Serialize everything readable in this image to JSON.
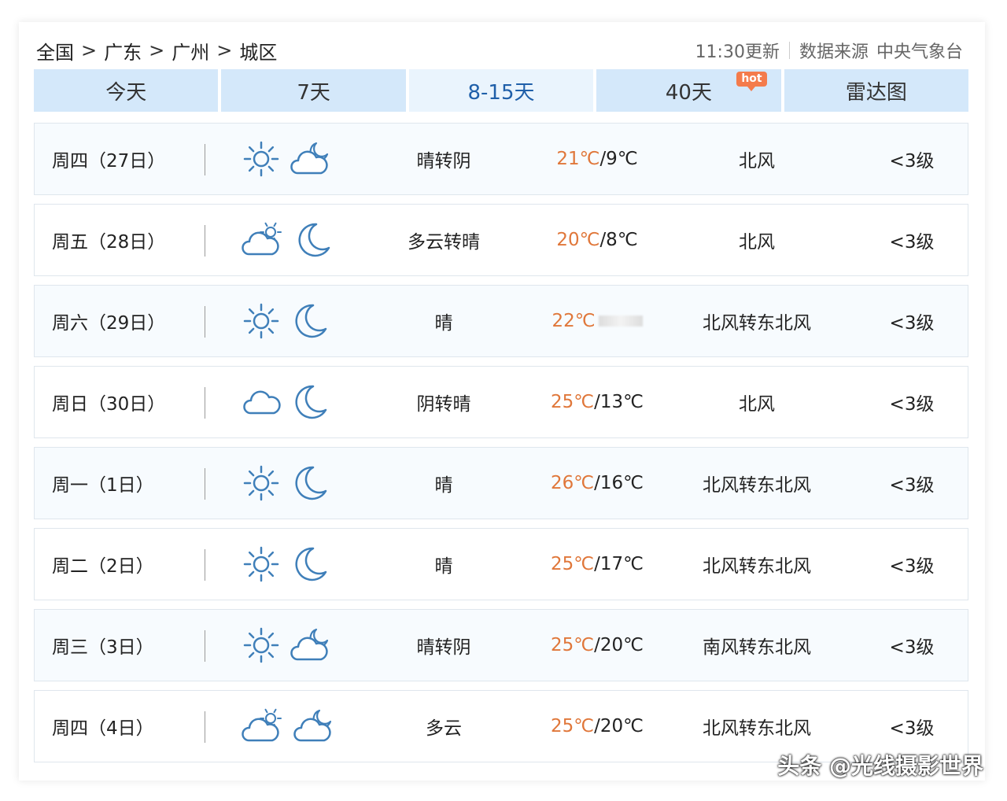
{
  "breadcrumb": [
    "全国",
    "广东",
    "广州",
    "城区"
  ],
  "breadcrumb_sep": ">",
  "meta": {
    "update": "11:30更新",
    "source_label": "数据来源",
    "source": "中央气象台"
  },
  "tabs": [
    {
      "label": "今天",
      "active": false
    },
    {
      "label": "7天",
      "active": false
    },
    {
      "label": "8-15天",
      "active": true
    },
    {
      "label": "40天",
      "active": false,
      "badge": "hot"
    },
    {
      "label": "雷达图",
      "active": false
    }
  ],
  "colors": {
    "tab_bg": "#d4e8fa",
    "tab_active_text": "#1f5fa9",
    "high_temp": "#e0773a",
    "icon_blue": "#3f7fb9",
    "badge": "#f47b4b"
  },
  "forecast": [
    {
      "day": "周四（27日）",
      "icons": [
        "sun-icon",
        "cloud-moon-icon"
      ],
      "desc": "晴转阴",
      "high": "21℃",
      "low": "/9℃",
      "wind": "北风",
      "level": "<3级"
    },
    {
      "day": "周五（28日）",
      "icons": [
        "cloud-sun-icon",
        "moon-icon"
      ],
      "desc": "多云转晴",
      "high": "20℃",
      "low": "/8℃",
      "wind": "北风",
      "level": "<3级"
    },
    {
      "day": "周六（29日）",
      "icons": [
        "sun-icon",
        "moon-icon"
      ],
      "desc": "晴",
      "high": "22℃",
      "low": "",
      "wind": "北风转东北风",
      "level": "<3级"
    },
    {
      "day": "周日（30日）",
      "icons": [
        "cloud-icon",
        "moon-icon"
      ],
      "desc": "阴转晴",
      "high": "25℃",
      "low": "/13℃",
      "wind": "北风",
      "level": "<3级"
    },
    {
      "day": "周一（1日）",
      "icons": [
        "sun-icon",
        "moon-icon"
      ],
      "desc": "晴",
      "high": "26℃",
      "low": "/16℃",
      "wind": "北风转东北风",
      "level": "<3级"
    },
    {
      "day": "周二（2日）",
      "icons": [
        "sun-icon",
        "moon-icon"
      ],
      "desc": "晴",
      "high": "25℃",
      "low": "/17℃",
      "wind": "北风转东北风",
      "level": "<3级"
    },
    {
      "day": "周三（3日）",
      "icons": [
        "sun-icon",
        "cloud-moon-icon"
      ],
      "desc": "晴转阴",
      "high": "25℃",
      "low": "/20℃",
      "wind": "南风转东北风",
      "level": "<3级"
    },
    {
      "day": "周四（4日）",
      "icons": [
        "cloud-sun-icon",
        "cloud-moon-icon"
      ],
      "desc": "多云",
      "high": "25℃",
      "low": "/20℃",
      "wind": "北风转东北风",
      "level": "<3级"
    }
  ],
  "watermark": "头条 @光线摄影世界"
}
